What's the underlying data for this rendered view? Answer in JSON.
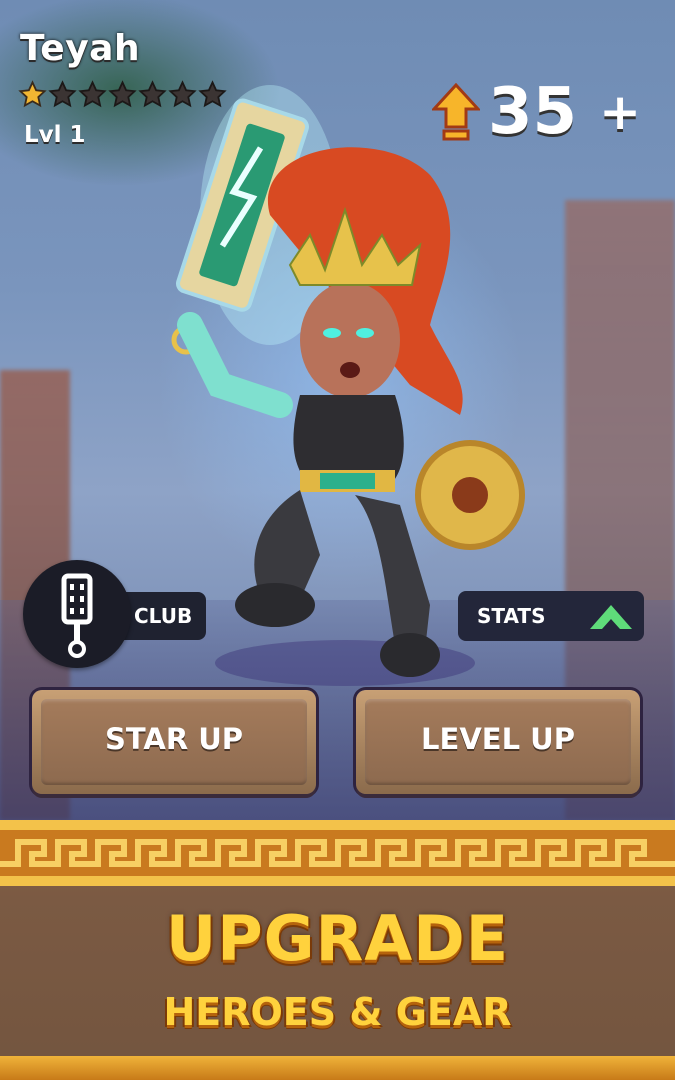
{
  "hero": {
    "name": "Teyah",
    "stars_filled": 1,
    "stars_total": 7,
    "level_label": "Lvl 1"
  },
  "power": {
    "value": "35",
    "plus": "+",
    "icon": "gold-up-arrow-icon"
  },
  "weapon_type": {
    "label": "CLUB",
    "icon": "club-icon"
  },
  "stats": {
    "label": "STATS",
    "icon": "chevron-up-icon",
    "icon_color": "#5fdc7a"
  },
  "buttons": {
    "star_up": "STAR UP",
    "level_up": "LEVEL UP"
  },
  "banner": {
    "headline": "UPGRADE",
    "subheadline": "HEROES & GEAR"
  },
  "colors": {
    "star_gold": "#f2b632",
    "banner_text": "#ffd23d",
    "banner_bg": "#7b5a43"
  }
}
